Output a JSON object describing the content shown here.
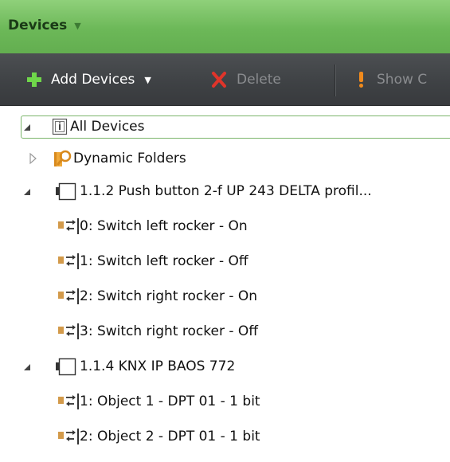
{
  "panel": {
    "title": "Devices",
    "title_caret": "▼"
  },
  "toolbar": {
    "add_label": "Add Devices",
    "add_caret": "▼",
    "delete_label": "Delete",
    "show_label": "Show C"
  },
  "tree": {
    "all_devices": "All Devices",
    "dynamic_folders": "Dynamic Folders",
    "device1": {
      "label": "1.1.2  Push button 2-f UP 243 DELTA profil...",
      "objects": [
        "0: Switch left rocker - On",
        "1: Switch left rocker - Off",
        "2: Switch right rocker - On",
        "3: Switch right rocker - Off"
      ]
    },
    "device2": {
      "label": "1.1.4  KNX IP BAOS 772",
      "objects": [
        "1: Object 1 - DPT 01 - 1 bit",
        "2: Object 2 - DPT 01 - 1 bit"
      ]
    }
  },
  "colors": {
    "header_green": "#6cb858",
    "toolbar_dark": "#3e4144",
    "selection_border": "#7bb56b",
    "add_icon": "#6fd64a",
    "delete_icon": "#e0342a",
    "show_icon": "#f08a1c",
    "object_icon": "#d39a4a"
  },
  "icons": {
    "add": "plus-icon",
    "delete": "x-icon",
    "show": "exclamation-icon",
    "all_devices": "device-list-icon",
    "dynamic_folders": "folder-search-icon",
    "device": "device-module-icon",
    "object": "group-object-icon"
  }
}
